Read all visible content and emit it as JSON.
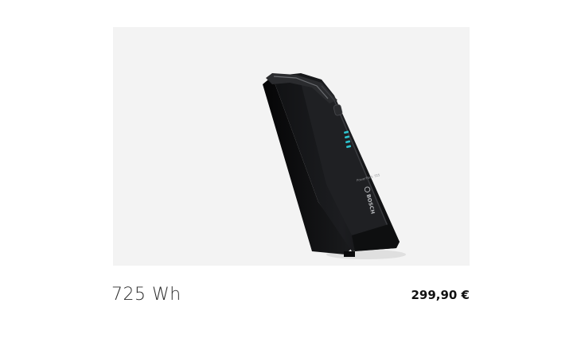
{
  "product": {
    "capacity": "725 Wh",
    "price": "299,90 €",
    "image": {
      "subject": "battery-pack",
      "brand_mark": "BOSCH",
      "model_text": "PowerPack 725",
      "frame_color": "#f3f3f3",
      "indicator_color": "#2ec4cf"
    }
  }
}
